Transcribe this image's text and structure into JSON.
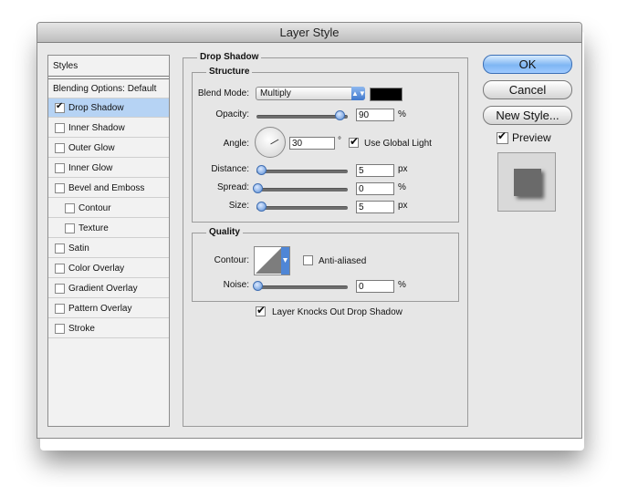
{
  "window": {
    "title": "Layer Style"
  },
  "sidebar": {
    "header": "Styles",
    "blending": "Blending Options: Default",
    "items": [
      {
        "label": "Drop Shadow",
        "checked": true,
        "selected": true
      },
      {
        "label": "Inner Shadow",
        "checked": false
      },
      {
        "label": "Outer Glow",
        "checked": false
      },
      {
        "label": "Inner Glow",
        "checked": false
      },
      {
        "label": "Bevel and Emboss",
        "checked": false
      },
      {
        "label": "Contour",
        "checked": false,
        "indent": true
      },
      {
        "label": "Texture",
        "checked": false,
        "indent": true
      },
      {
        "label": "Satin",
        "checked": false
      },
      {
        "label": "Color Overlay",
        "checked": false
      },
      {
        "label": "Gradient Overlay",
        "checked": false
      },
      {
        "label": "Pattern Overlay",
        "checked": false
      },
      {
        "label": "Stroke",
        "checked": false
      }
    ]
  },
  "panel": {
    "title": "Drop Shadow",
    "structure": {
      "title": "Structure",
      "blend_mode_label": "Blend Mode:",
      "blend_mode_value": "Multiply",
      "shadow_color": "#000000",
      "opacity_label": "Opacity:",
      "opacity_value": "90",
      "opacity_unit": "%",
      "opacity_level": 0.9,
      "angle_label": "Angle:",
      "angle_value": "30",
      "angle_unit": "°",
      "use_global_light_label": "Use Global Light",
      "use_global_light": true,
      "distance_label": "Distance:",
      "distance_value": "5",
      "distance_unit": "px",
      "spread_label": "Spread:",
      "spread_value": "0",
      "spread_unit": "%",
      "size_label": "Size:",
      "size_value": "5",
      "size_unit": "px"
    },
    "quality": {
      "title": "Quality",
      "contour_label": "Contour:",
      "anti_aliased_label": "Anti-aliased",
      "anti_aliased": false,
      "noise_label": "Noise:",
      "noise_value": "0",
      "noise_unit": "%"
    },
    "knockout_label": "Layer Knocks Out Drop Shadow",
    "knockout": true
  },
  "buttons": {
    "ok": "OK",
    "cancel": "Cancel",
    "new_style": "New Style...",
    "preview_label": "Preview",
    "preview_checked": true
  }
}
